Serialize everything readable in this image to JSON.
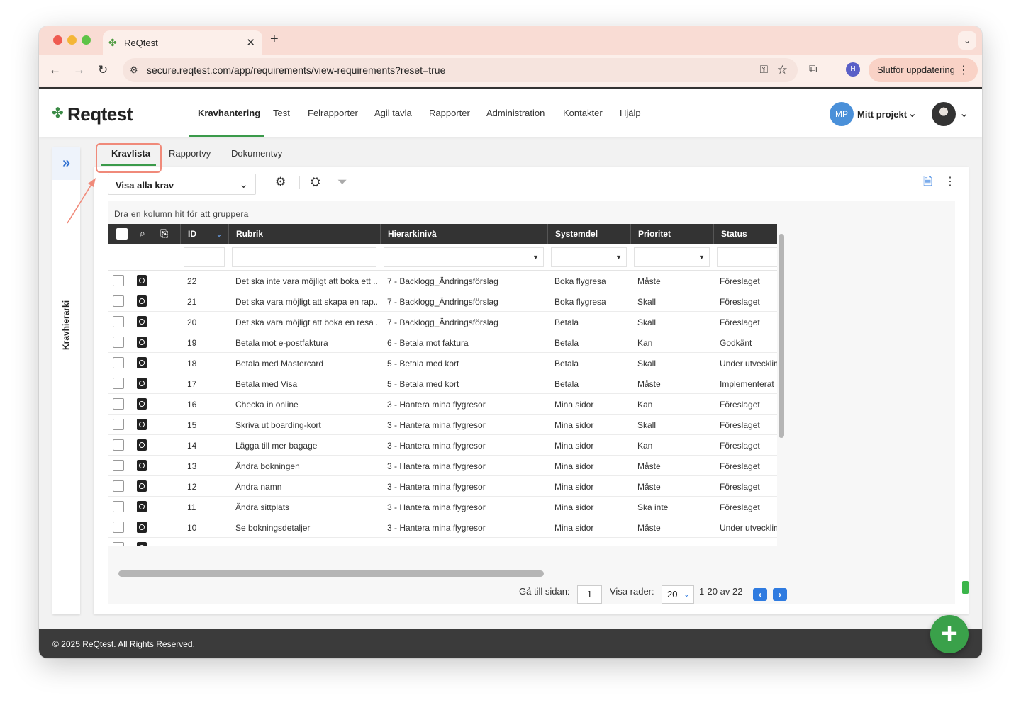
{
  "browser": {
    "tab_title": "ReQtest",
    "tab_close": "✕",
    "new_tab": "+",
    "url": "secure.reqtest.com/app/requirements/view-requirements?reset=true",
    "profile_initial": "H",
    "update_label": "Slutför uppdatering"
  },
  "app": {
    "logo_text": "Reqtest",
    "nav": [
      "Kravhantering",
      "Test",
      "Felrapporter",
      "Agil tavla",
      "Rapporter",
      "Administration",
      "Kontakter",
      "Hjälp"
    ],
    "project_initials": "MP",
    "project_label": "Mitt projekt"
  },
  "sidebar": {
    "label": "Kravhierarki"
  },
  "subtabs": [
    "Kravlista",
    "Rapportvy",
    "Dokumentvy"
  ],
  "toolbar": {
    "view_select": "Visa alla krav"
  },
  "grid": {
    "group_hint": "Dra en kolumn hit för att gruppera",
    "columns": [
      "ID",
      "Rubrik",
      "Hierarkinivå",
      "Systemdel",
      "Prioritet",
      "Status"
    ],
    "rows": [
      {
        "id": "22",
        "rubrik": "Det ska inte vara möjligt att boka ett ...",
        "hierarki": "7 - Backlogg_Ändringsförslag",
        "systemdel": "Boka flygresa",
        "prioritet": "Måste",
        "status": "Föreslaget"
      },
      {
        "id": "21",
        "rubrik": "Det ska vara möjligt att skapa en rap...",
        "hierarki": "7 - Backlogg_Ändringsförslag",
        "systemdel": "Boka flygresa",
        "prioritet": "Skall",
        "status": "Föreslaget"
      },
      {
        "id": "20",
        "rubrik": "Det ska vara möjligt att boka en resa ...",
        "hierarki": "7 - Backlogg_Ändringsförslag",
        "systemdel": "Betala",
        "prioritet": "Skall",
        "status": "Föreslaget"
      },
      {
        "id": "19",
        "rubrik": "Betala mot e-postfaktura",
        "hierarki": "6 - Betala mot faktura",
        "systemdel": "Betala",
        "prioritet": "Kan",
        "status": "Godkänt"
      },
      {
        "id": "18",
        "rubrik": "Betala med Mastercard",
        "hierarki": "5 - Betala med kort",
        "systemdel": "Betala",
        "prioritet": "Skall",
        "status": "Under utveckling"
      },
      {
        "id": "17",
        "rubrik": "Betala med Visa",
        "hierarki": "5 - Betala med kort",
        "systemdel": "Betala",
        "prioritet": "Måste",
        "status": "Implementerat"
      },
      {
        "id": "16",
        "rubrik": "Checka in online",
        "hierarki": "3 - Hantera mina flygresor",
        "systemdel": "Mina sidor",
        "prioritet": "Kan",
        "status": "Föreslaget"
      },
      {
        "id": "15",
        "rubrik": "Skriva ut boarding-kort",
        "hierarki": "3 - Hantera mina flygresor",
        "systemdel": "Mina sidor",
        "prioritet": "Skall",
        "status": "Föreslaget"
      },
      {
        "id": "14",
        "rubrik": "Lägga till mer bagage",
        "hierarki": "3 - Hantera mina flygresor",
        "systemdel": "Mina sidor",
        "prioritet": "Kan",
        "status": "Föreslaget"
      },
      {
        "id": "13",
        "rubrik": "Ändra bokningen",
        "hierarki": "3 - Hantera mina flygresor",
        "systemdel": "Mina sidor",
        "prioritet": "Måste",
        "status": "Föreslaget"
      },
      {
        "id": "12",
        "rubrik": "Ändra namn",
        "hierarki": "3 - Hantera mina flygresor",
        "systemdel": "Mina sidor",
        "prioritet": "Måste",
        "status": "Föreslaget"
      },
      {
        "id": "11",
        "rubrik": "Ändra sittplats",
        "hierarki": "3 - Hantera mina flygresor",
        "systemdel": "Mina sidor",
        "prioritet": "Ska inte",
        "status": "Föreslaget"
      },
      {
        "id": "10",
        "rubrik": "Se bokningsdetaljer",
        "hierarki": "3 - Hantera mina flygresor",
        "systemdel": "Mina sidor",
        "prioritet": "Måste",
        "status": "Under utveckling"
      }
    ]
  },
  "pager": {
    "goto_label": "Gå till sidan:",
    "page": "1",
    "rows_label": "Visa rader:",
    "rows_per_page": "20",
    "range": "1-20 av 22"
  },
  "footer": {
    "copyright": "© 2025 ReQtest. All Rights Reserved."
  },
  "colors": {
    "accent_green": "#3a9a4a",
    "link_blue": "#2f7be0",
    "header_dark": "#333333"
  }
}
